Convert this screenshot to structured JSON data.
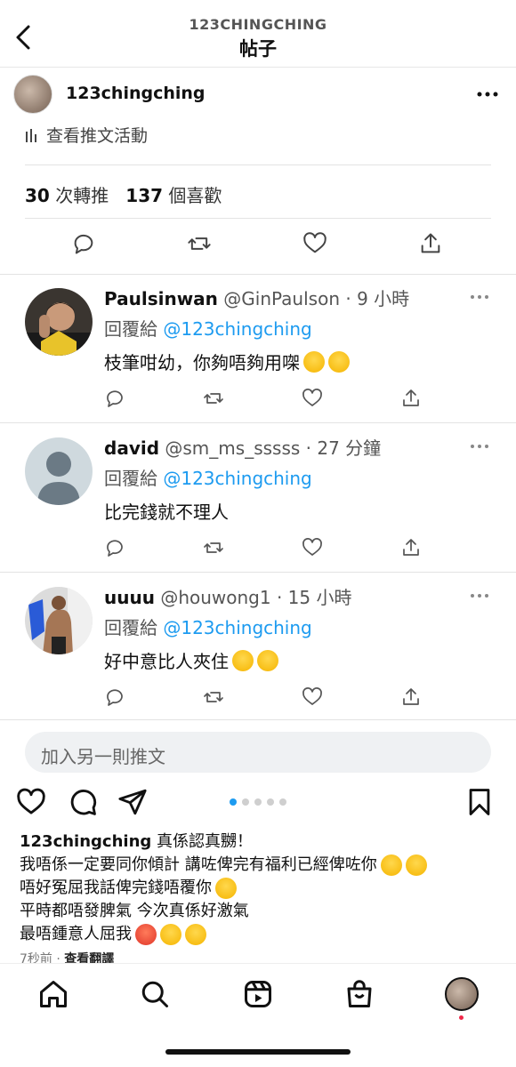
{
  "header": {
    "subtitle": "123CHINGCHING",
    "title": "帖子"
  },
  "post": {
    "username": "123chingching"
  },
  "tweet": {
    "view_activity": "查看推文活動",
    "retweets_count": "30",
    "retweets_label": "次轉推",
    "likes_count": "137",
    "likes_label": "個喜歡",
    "replies": [
      {
        "name": "Paulsinwan",
        "handle": "@GinPaulson",
        "time": "9 小時",
        "reply_to_label": "回覆給",
        "reply_to": "@123chingching",
        "text": "枝筆咁幼，你夠唔夠用㗎"
      },
      {
        "name": "david",
        "handle": "@sm_ms_sssss",
        "time": "27 分鐘",
        "reply_to_label": "回覆給",
        "reply_to": "@123chingching",
        "text": "比完錢就不理人"
      },
      {
        "name": "uuuu",
        "handle": "@houwong1",
        "time": "15 小時",
        "reply_to_label": "回覆給",
        "reply_to": "@123chingching",
        "text": "好中意比人夾住"
      }
    ],
    "add_tweet_placeholder": "加入另一則推文"
  },
  "caption": {
    "username": "123chingching",
    "line1": "真係認真嬲！",
    "line2": "我唔係一定要同你傾計 講咗俾完有福利已經俾咗你",
    "line3": "唔好冤屈我話俾完錢唔覆你",
    "line4": "平時都唔發脾氣 今次真係好激氣",
    "line5": "最唔鍾意人屈我"
  },
  "meta": {
    "time_ago": "7秒前",
    "separator": "·",
    "translate": "查看翻譯"
  },
  "carousel": {
    "count": 5,
    "active": 0
  },
  "colors": {
    "accent": "#1d9bf0",
    "text": "#111111",
    "muted": "#555555"
  }
}
